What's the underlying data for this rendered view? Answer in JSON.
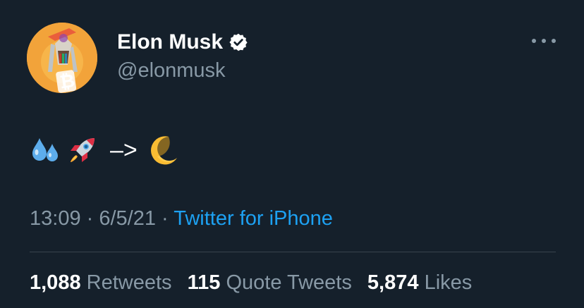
{
  "author": {
    "display_name": "Elon Musk",
    "handle": "@elonmusk",
    "verified": true
  },
  "tweet": {
    "emojis": [
      "sweat-droplets-icon",
      "rocket-icon",
      "crescent-moon-icon"
    ],
    "arrow": "–>"
  },
  "meta": {
    "time": "13:09",
    "sep1": " · ",
    "date": "6/5/21",
    "sep2": " · ",
    "source": "Twitter for iPhone"
  },
  "stats": {
    "retweets_count": "1,088",
    "retweets_label": "Retweets",
    "quotes_count": "115",
    "quotes_label": "Quote Tweets",
    "likes_count": "5,874",
    "likes_label": "Likes"
  },
  "colors": {
    "background": "#15202b",
    "text_primary": "#ffffff",
    "text_secondary": "#8899a6",
    "link": "#1da1f2",
    "divider": "#38444d"
  }
}
